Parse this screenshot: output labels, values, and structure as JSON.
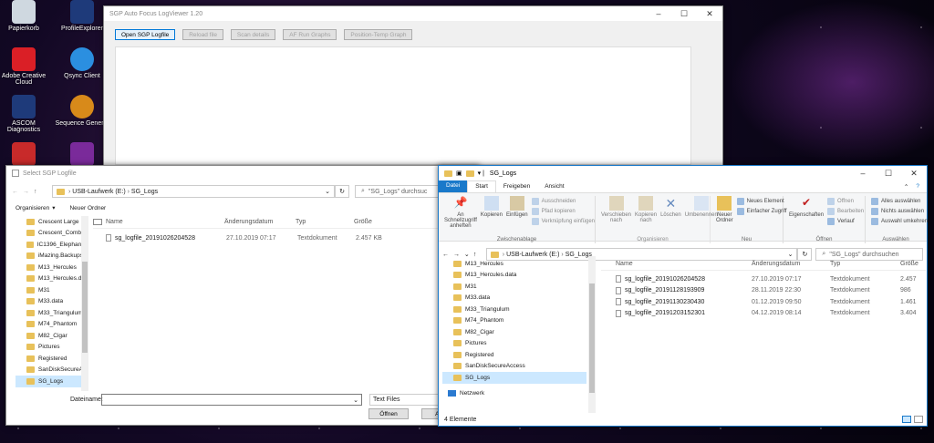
{
  "desktop": {
    "icons": [
      "Papierkorb",
      "ProfileExplorer",
      "Adobe Creative Cloud",
      "Qsync Client",
      "ASCOM Diagnostics",
      "Sequence Generat"
    ]
  },
  "logviewer": {
    "title": "SGP Auto Focus LogViewer 1.20",
    "buttons": [
      "Open SGP Logfile",
      "Reload file",
      "Scan details",
      "AF Run Graphs",
      "Position-Temp Graph"
    ]
  },
  "dialog": {
    "title": "Select SGP Logfile",
    "path": [
      "USB-Laufwerk (E:)",
      "SG_Logs"
    ],
    "search": "\"SG_Logs\" durchsuc",
    "organize": "Organisieren",
    "newfolder": "Neuer Ordner",
    "headers": [
      "Name",
      "Änderungsdatum",
      "Typ",
      "Größe"
    ],
    "files": [
      {
        "name": "sg_logfile_20191026204528",
        "date": "27.10.2019 07:17",
        "type": "Textdokument",
        "size": "2.457 KB"
      }
    ],
    "tree": [
      "Crescent Large",
      "Crescent_Combi",
      "IC1396_Elephant",
      "iMazing.Backups",
      "M13_Hercules",
      "M13_Hercules.d",
      "M31",
      "M33.data",
      "M33_Triangulum",
      "M74_Phantom",
      "M82_Cigar",
      "Pictures",
      "Registered",
      "SanDiskSecureA",
      "SG_Logs"
    ],
    "filename_label": "Dateiname:",
    "filter": "Text Files",
    "open": "Öffnen",
    "cancel": "Abbr"
  },
  "explorer": {
    "title": "SG_Logs",
    "tabs": [
      "Datei",
      "Start",
      "Freigeben",
      "Ansicht"
    ],
    "ribbon": {
      "pin": "An Schnellzugriff anheften",
      "copy": "Kopieren",
      "paste": "Einfügen",
      "cut": "Ausschneiden",
      "copypath": "Pfad kopieren",
      "pasteshortcut": "Verknüpfung einfügen",
      "clipboard": "Zwischenablage",
      "move": "Verschieben nach",
      "copyto": "Kopieren nach",
      "delete": "Löschen",
      "rename": "Umbenennen",
      "organize": "Organisieren",
      "newfolder": "Neuer Ordner",
      "newitem": "Neues Element",
      "easyaccess": "Einfacher Zugriff",
      "new": "Neu",
      "properties": "Eigenschaften",
      "openbtn": "Öffnen",
      "edit": "Bearbeiten",
      "history": "Verlauf",
      "open": "Öffnen",
      "selectall": "Alles auswählen",
      "selectnone": "Nichts auswählen",
      "invert": "Auswahl umkehren",
      "select": "Auswählen"
    },
    "path": [
      "USB-Laufwerk (E:)",
      "SG_Logs"
    ],
    "search": "\"SG_Logs\" durchsuchen",
    "tree": [
      "M13_Hercules",
      "M13_Hercules.data",
      "M31",
      "M33.data",
      "M33_Triangulum",
      "M74_Phantom",
      "M82_Cigar",
      "Pictures",
      "Registered",
      "SanDiskSecureAccess",
      "SG_Logs"
    ],
    "network": "Netzwerk",
    "headers": [
      "Name",
      "Änderungsdatum",
      "Typ",
      "Größe"
    ],
    "files": [
      {
        "name": "sg_logfile_20191026204528",
        "date": "27.10.2019 07:17",
        "type": "Textdokument",
        "size": "2.457"
      },
      {
        "name": "sg_logfile_20191128193909",
        "date": "28.11.2019 22:30",
        "type": "Textdokument",
        "size": "986"
      },
      {
        "name": "sg_logfile_20191130230430",
        "date": "01.12.2019 09:50",
        "type": "Textdokument",
        "size": "1.461"
      },
      {
        "name": "sg_logfile_20191203152301",
        "date": "04.12.2019 08:14",
        "type": "Textdokument",
        "size": "3.404"
      }
    ],
    "status": "4 Elemente"
  }
}
